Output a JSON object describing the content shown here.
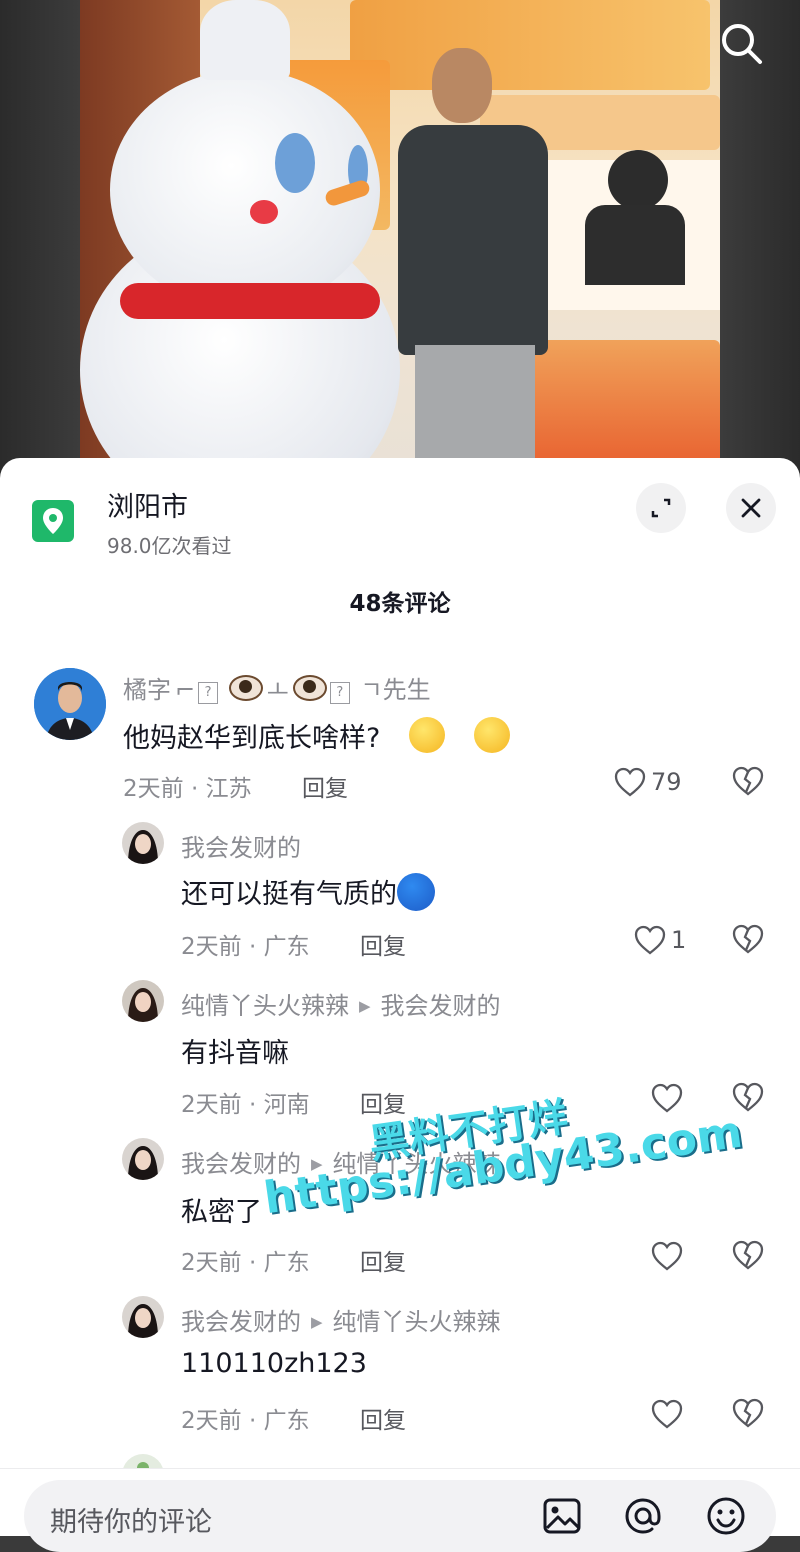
{
  "location": {
    "name": "浏阳市",
    "views": "98.0亿次看过"
  },
  "comment_count_label": "48条评论",
  "comments": [
    {
      "user_prefix": "橘字",
      "user_suffix": "先生",
      "text": "他妈赵华到底长啥样?",
      "time_place": "2天前 · 江苏",
      "reply_label": "回复",
      "likes": "79"
    },
    {
      "user": "我会发财的",
      "text": "还可以挺有气质的",
      "time_place": "2天前 · 广东",
      "reply_label": "回复",
      "likes": "1"
    },
    {
      "user": "纯情丫头火辣辣",
      "reply_to": "我会发财的",
      "text": "有抖音嘛",
      "time_place": "2天前 · 河南",
      "reply_label": "回复"
    },
    {
      "user": "我会发财的",
      "reply_to": "纯情丫头火辣辣",
      "text": "私密了",
      "time_place": "2天前 · 广东",
      "reply_label": "回复"
    },
    {
      "user": "我会发财的",
      "reply_to": "纯情丫头火辣辣",
      "text": "110110zh123",
      "time_place": "2天前 · 广东",
      "reply_label": "回复"
    }
  ],
  "watermark": {
    "line1": "黑料不打烊",
    "line2": "https://abdy43.com"
  },
  "input": {
    "placeholder": "期待你的评论"
  },
  "icons": {
    "search": "search-icon",
    "location": "location-pin-icon",
    "expand": "expand-icon",
    "close": "close-icon",
    "like": "heart-icon",
    "dislike": "broken-heart-icon",
    "image": "image-icon",
    "mention": "at-icon",
    "emoji": "emoji-icon"
  },
  "colors": {
    "location_green": "#1fb86a",
    "watermark_cyan": "#4ad9e8"
  }
}
